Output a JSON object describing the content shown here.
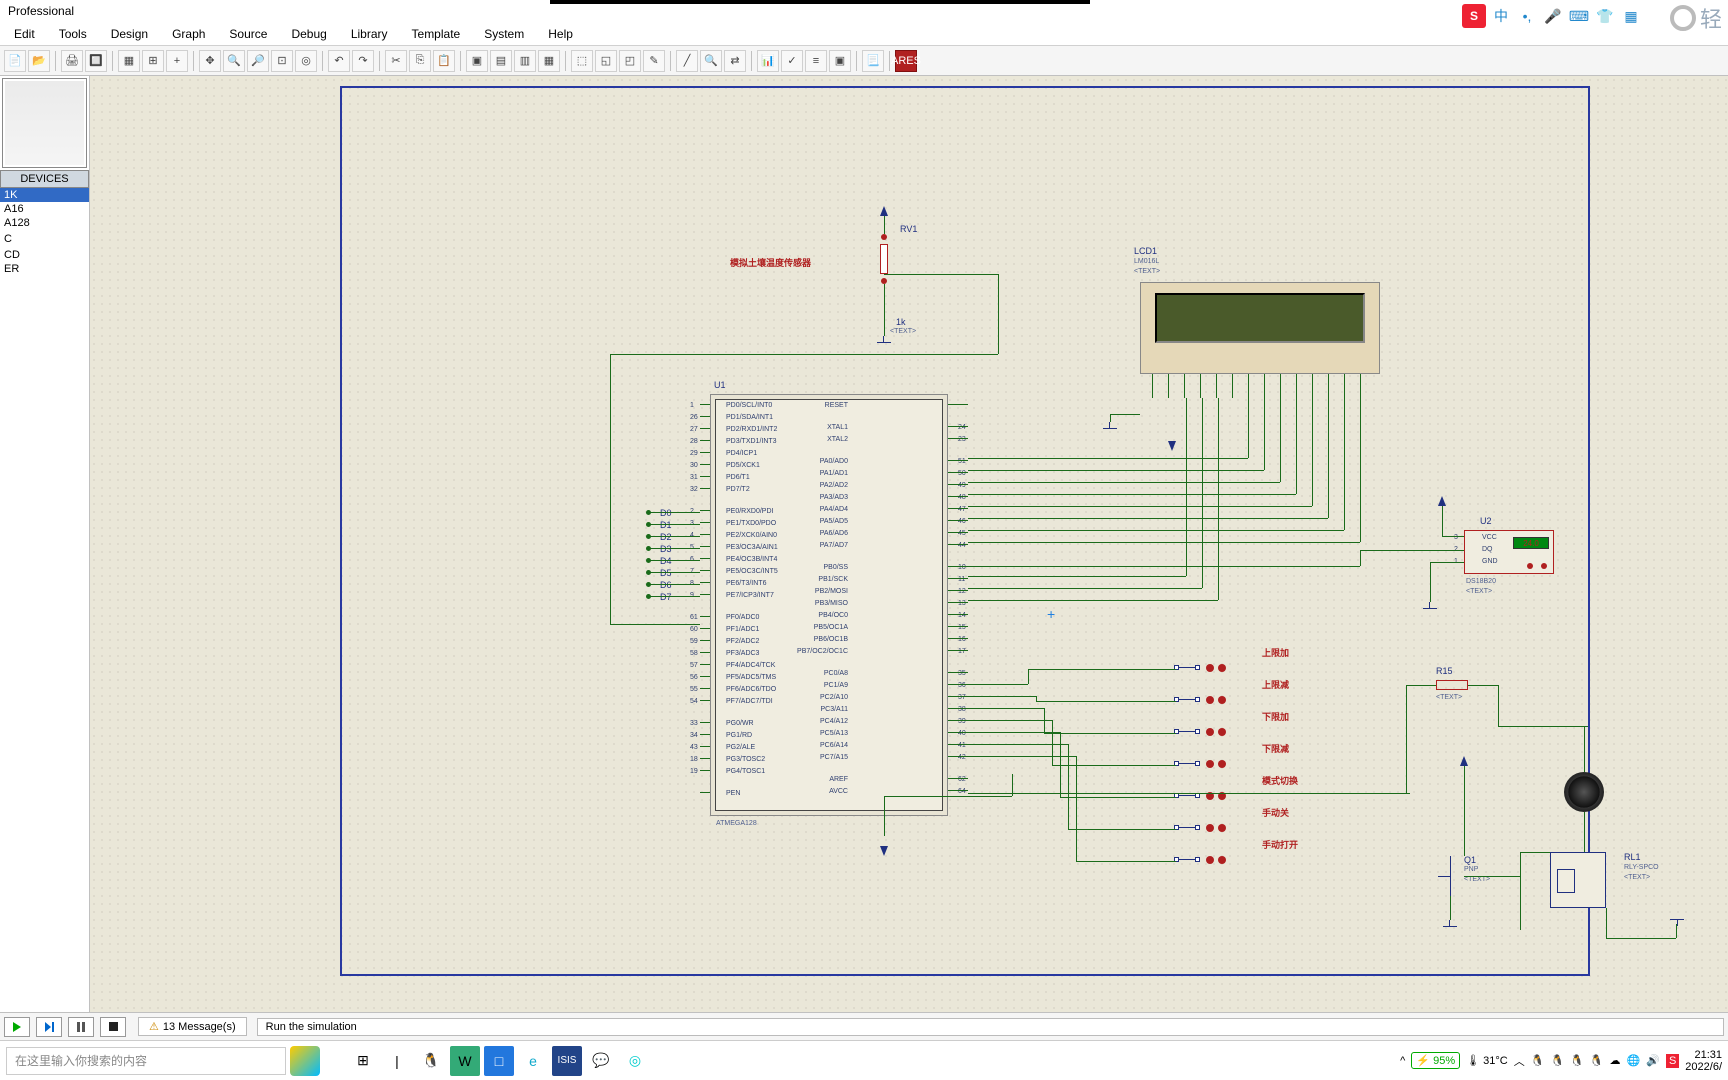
{
  "title": "Professional",
  "menu": [
    "Edit",
    "Tools",
    "Design",
    "Graph",
    "Source",
    "Debug",
    "Library",
    "Template",
    "System",
    "Help"
  ],
  "devices_header": "DEVICES",
  "devices": [
    "1K",
    "A16",
    "A128",
    "",
    "C",
    "",
    "CD",
    "ER"
  ],
  "components": {
    "rv1": "RV1",
    "sensorLabel": "模拟土壤温度传感器",
    "rv1val": "1k",
    "rv1txt": "<TEXT>",
    "u1": "U1",
    "u1part": "ATMEGA128",
    "lcd": "LCD1",
    "lcdpart": "LM016L",
    "lcdtxt": "<TEXT>",
    "u2": "U2",
    "u2part": "DS18B20",
    "u2txt": "<TEXT>",
    "u2disp": "24.0",
    "r15": "R15",
    "r15txt": "<TEXT>",
    "q1": "Q1",
    "q1part": "PNP",
    "q1txt": "<TEXT>",
    "rl1": "RL1",
    "rl1part": "RLY-SPCO",
    "rl1txt": "<TEXT>",
    "buttons": [
      "上限加",
      "上限减",
      "下限加",
      "下限减",
      "模式切换",
      "手动关",
      "手动打开"
    ],
    "u2pins": [
      "VCC",
      "DQ",
      "GND"
    ],
    "u1_left_pins": [
      {
        "no": "1",
        "n": "PD0/SCL/INT0"
      },
      {
        "no": "26",
        "n": "PD1/SDA/INT1"
      },
      {
        "no": "27",
        "n": "PD2/RXD1/INT2"
      },
      {
        "no": "28",
        "n": "PD3/TXD1/INT3"
      },
      {
        "no": "29",
        "n": "PD4/ICP1"
      },
      {
        "no": "30",
        "n": "PD5/XCK1"
      },
      {
        "no": "31",
        "n": "PD6/T1"
      },
      {
        "no": "32",
        "n": "PD7/T2"
      },
      {
        "no": "2",
        "n": "PE0/RXD0/PDI"
      },
      {
        "no": "3",
        "n": "PE1/TXD0/PDO"
      },
      {
        "no": "4",
        "n": "PE2/XCK0/AIN0"
      },
      {
        "no": "5",
        "n": "PE3/OC3A/AIN1"
      },
      {
        "no": "6",
        "n": "PE4/OC3B/INT4"
      },
      {
        "no": "7",
        "n": "PE5/OC3C/INT5"
      },
      {
        "no": "8",
        "n": "PE6/T3/INT6"
      },
      {
        "no": "9",
        "n": "PE7/ICP3/INT7"
      },
      {
        "no": "61",
        "n": "PF0/ADC0"
      },
      {
        "no": "60",
        "n": "PF1/ADC1"
      },
      {
        "no": "59",
        "n": "PF2/ADC2"
      },
      {
        "no": "58",
        "n": "PF3/ADC3"
      },
      {
        "no": "57",
        "n": "PF4/ADC4/TCK"
      },
      {
        "no": "56",
        "n": "PF5/ADC5/TMS"
      },
      {
        "no": "55",
        "n": "PF6/ADC6/TDO"
      },
      {
        "no": "54",
        "n": "PF7/ADC7/TDI"
      },
      {
        "no": "33",
        "n": "PG0/WR"
      },
      {
        "no": "34",
        "n": "PG1/RD"
      },
      {
        "no": "43",
        "n": "PG2/ALE"
      },
      {
        "no": "18",
        "n": "PG3/TOSC2"
      },
      {
        "no": "19",
        "n": "PG4/TOSC1"
      },
      {
        "no": "",
        "n": "PEN"
      }
    ],
    "u1_right_pins": [
      {
        "no": "",
        "n": "RESET"
      },
      {
        "no": "24",
        "n": "XTAL1"
      },
      {
        "no": "23",
        "n": "XTAL2"
      },
      {
        "no": "51",
        "n": "PA0/AD0"
      },
      {
        "no": "50",
        "n": "PA1/AD1"
      },
      {
        "no": "49",
        "n": "PA2/AD2"
      },
      {
        "no": "48",
        "n": "PA3/AD3"
      },
      {
        "no": "47",
        "n": "PA4/AD4"
      },
      {
        "no": "46",
        "n": "PA5/AD5"
      },
      {
        "no": "45",
        "n": "PA6/AD6"
      },
      {
        "no": "44",
        "n": "PA7/AD7"
      },
      {
        "no": "10",
        "n": "PB0/SS"
      },
      {
        "no": "11",
        "n": "PB1/SCK"
      },
      {
        "no": "12",
        "n": "PB2/MOSI"
      },
      {
        "no": "13",
        "n": "PB3/MISO"
      },
      {
        "no": "14",
        "n": "PB4/OC0"
      },
      {
        "no": "15",
        "n": "PB5/OC1A"
      },
      {
        "no": "16",
        "n": "PB6/OC1B"
      },
      {
        "no": "17",
        "n": "PB7/OC2/OC1C"
      },
      {
        "no": "35",
        "n": "PC0/A8"
      },
      {
        "no": "36",
        "n": "PC1/A9"
      },
      {
        "no": "37",
        "n": "PC2/A10"
      },
      {
        "no": "38",
        "n": "PC3/A11"
      },
      {
        "no": "39",
        "n": "PC4/A12"
      },
      {
        "no": "40",
        "n": "PC5/A13"
      },
      {
        "no": "41",
        "n": "PC6/A14"
      },
      {
        "no": "42",
        "n": "PC7/A15"
      },
      {
        "no": "62",
        "n": "AREF"
      },
      {
        "no": "64",
        "n": "AVCC"
      }
    ],
    "pe_labels": [
      "D0",
      "D1",
      "D2",
      "D3",
      "D4",
      "D5",
      "D6",
      "D7"
    ]
  },
  "messages": "13 Message(s)",
  "status": "Run the simulation",
  "search_placeholder": "在这里输入你搜索的内容",
  "tray": {
    "temp": "31°C",
    "batt": "95%",
    "time": "21:31",
    "date": "2022/6/"
  },
  "lite": "轻"
}
